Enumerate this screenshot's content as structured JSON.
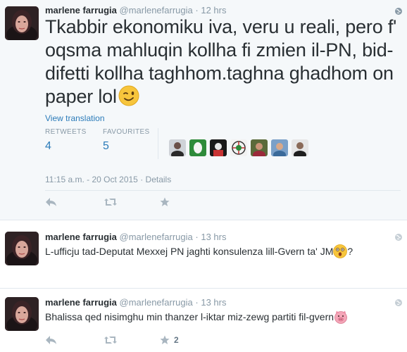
{
  "main_tweet": {
    "name": "marlene farrugia",
    "handle": "@marlenefarrugia",
    "dot": "·",
    "time": "12 hrs",
    "text": "Tkabbir ekonomiku iva, veru u reali, pero f' oqsma mahluqin kollha fi zmien il-PN, bid-difetti kollha taghhom.taghna ghadhom  on paper lol",
    "emoji_icon": "winking-face-emoji",
    "view_translation": "View translation",
    "retweets_label": "RETWEETS",
    "retweets_value": "4",
    "favourites_label": "FAVOURITES",
    "favourites_value": "5",
    "timestamp": "11:15 a.m. - 20 Oct 2015",
    "meta_dot": "·",
    "details_link": "Details"
  },
  "tweets": [
    {
      "name": "marlene farrugia",
      "handle": "@marlenefarrugia",
      "dot": "·",
      "time": "13 hrs",
      "text": "L-ufficju tad-Deputat Mexxej PN jaghti konsulenza lill-Gvern ta' JM",
      "trailing": "?",
      "emoji_icon": "astonished-face-emoji"
    },
    {
      "name": "marlene farrugia",
      "handle": "@marlenefarrugia",
      "dot": "·",
      "time": "13 hrs",
      "text": "Bhalissa qed nisimghu min thanzer l-iktar miz-zewg partiti fil-gvern",
      "emoji_icon": "pig-face-emoji",
      "retweet_count": "",
      "favourite_count": "2"
    }
  ],
  "colors": {
    "link": "#2b7bb9",
    "muted": "#8899a6",
    "text": "#292f33",
    "main_bg": "#f5f8fa"
  }
}
